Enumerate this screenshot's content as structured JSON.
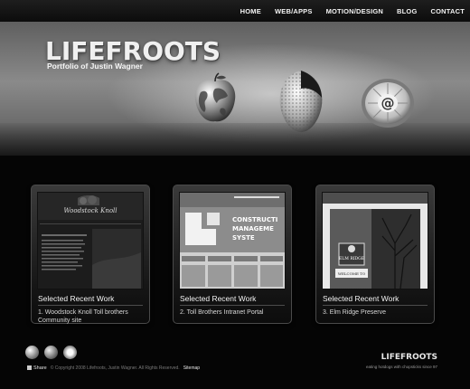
{
  "nav": {
    "items": [
      "HOME",
      "WEB/APPS",
      "MOTION/DESIGN",
      "BLOG",
      "CONTACT"
    ]
  },
  "hero": {
    "brand": "LIFEFROOTS",
    "tagline": "Portfolio of Justin Wagner",
    "icons": [
      "globe-apple-icon",
      "grater-fruit-icon",
      "email-orange-icon"
    ]
  },
  "cards": [
    {
      "title": "Selected Recent Work",
      "description": "1. Woodstock Knoll Toll brothers Community site",
      "thumb_text": [
        "Woodstock Knoll"
      ]
    },
    {
      "title": "Selected Recent Work",
      "description": "2. Toll Brothers Intranet Portal",
      "thumb_text": [
        "CONSTRUCTI",
        "MANAGEME",
        "SYSTE"
      ]
    },
    {
      "title": "Selected Recent Work",
      "description": "3. Elm Ridge Preserve",
      "thumb_text": [
        "ELM RIDGE",
        "WELCOME TO"
      ]
    }
  ],
  "footer": {
    "share": "Share",
    "copyright": "© Copyright 2008 Lifefroots, Justin Wagner. All Rights Reserved.",
    "sitemap": "Sitemap",
    "logo": "LIFEFROOTS",
    "logo_sub": "eating hotdogs with chopsticks since 97",
    "icons": [
      "globe-icon",
      "grater-icon",
      "email-icon"
    ]
  }
}
